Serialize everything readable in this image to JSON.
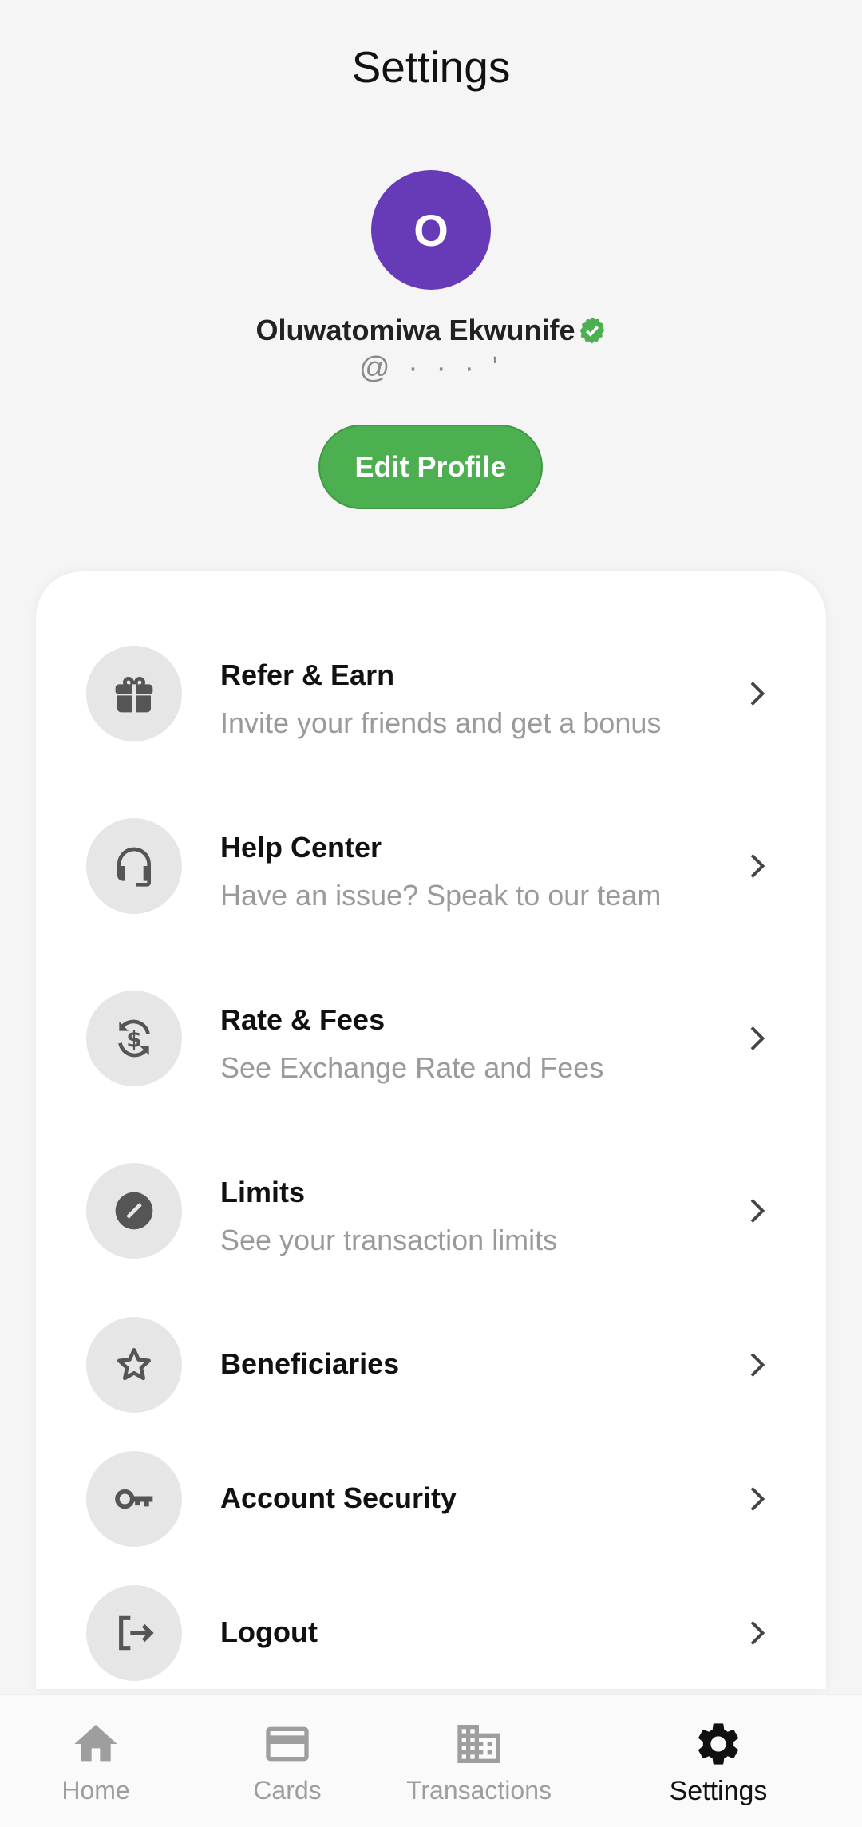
{
  "header": {
    "title": "Settings"
  },
  "profile": {
    "avatar_initial": "O",
    "avatar_color": "#673ab7",
    "name": "Oluwatomiwa Ekwunife",
    "handle": "@  ·  ·  ·  '",
    "verified": true,
    "edit_label": "Edit Profile"
  },
  "menu": [
    {
      "icon": "gift-icon",
      "title": "Refer & Earn",
      "subtitle": "Invite your friends and get a bonus"
    },
    {
      "icon": "headset-icon",
      "title": "Help Center",
      "subtitle": "Have an issue? Speak to our team"
    },
    {
      "icon": "currency-exchange-icon",
      "title": "Rate & Fees",
      "subtitle": "See Exchange Rate and Fees"
    },
    {
      "icon": "limit-icon",
      "title": "Limits",
      "subtitle": "See your transaction limits"
    },
    {
      "icon": "star-icon",
      "title": "Beneficiaries",
      "subtitle": ""
    },
    {
      "icon": "key-icon",
      "title": "Account Security",
      "subtitle": ""
    },
    {
      "icon": "logout-icon",
      "title": "Logout",
      "subtitle": ""
    }
  ],
  "bottom_nav": [
    {
      "icon": "home-icon",
      "label": "Home",
      "active": false
    },
    {
      "icon": "card-icon",
      "label": "Cards",
      "active": false
    },
    {
      "icon": "building-icon",
      "label": "Transactions",
      "active": false
    },
    {
      "icon": "gear-icon",
      "label": "Settings",
      "active": true
    }
  ],
  "colors": {
    "accent": "#4caf50",
    "avatar": "#673ab7",
    "icon_bg": "#e6e6e6",
    "subtitle": "#9a9a9a"
  }
}
